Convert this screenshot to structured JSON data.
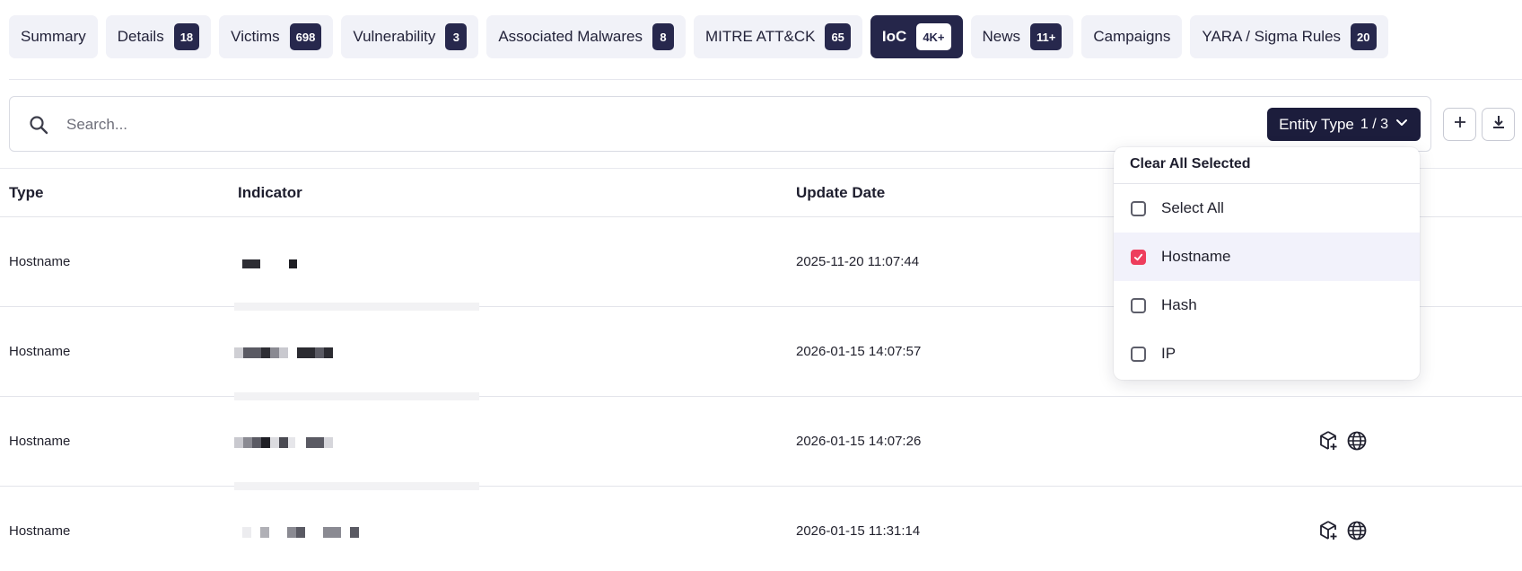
{
  "tabs": [
    {
      "label": "Summary",
      "badge": null
    },
    {
      "label": "Details",
      "badge": "18"
    },
    {
      "label": "Victims",
      "badge": "698"
    },
    {
      "label": "Vulnerability",
      "badge": "3"
    },
    {
      "label": "Associated Malwares",
      "badge": "8"
    },
    {
      "label": "MITRE ATT&CK",
      "badge": "65"
    },
    {
      "label": "IoC",
      "badge": "4K+",
      "active": true
    },
    {
      "label": "News",
      "badge": "11+"
    },
    {
      "label": "Campaigns",
      "badge": null
    },
    {
      "label": "YARA / Sigma Rules",
      "badge": "20"
    }
  ],
  "search": {
    "placeholder": "Search...",
    "entity_button": {
      "label": "Entity Type",
      "count": "1 / 3"
    }
  },
  "table": {
    "headers": {
      "type": "Type",
      "indicator": "Indicator",
      "update_date": "Update Date"
    },
    "rows": [
      {
        "type": "Hostname",
        "date": "2025-11-20 11:07:44",
        "actions": false
      },
      {
        "type": "Hostname",
        "date": "2026-01-15 14:07:57",
        "actions": false
      },
      {
        "type": "Hostname",
        "date": "2026-01-15 14:07:26",
        "actions": true
      },
      {
        "type": "Hostname",
        "date": "2026-01-15 11:31:14",
        "actions": true
      }
    ]
  },
  "dropdown": {
    "clear_label": "Clear All Selected",
    "options": [
      {
        "label": "Select All",
        "checked": false
      },
      {
        "label": "Hostname",
        "checked": true
      },
      {
        "label": "Hash",
        "checked": false
      },
      {
        "label": "IP",
        "checked": false
      }
    ]
  },
  "icons": {
    "search": "search-icon",
    "chevron": "chevron-down-icon",
    "add": "plus-icon",
    "download": "download-icon",
    "package": "package-add-icon",
    "globe": "globe-icon"
  },
  "colors": {
    "accent_dark": "#1c1d3c",
    "badge": "#27284d",
    "checkbox_checked": "#ee3d5c"
  }
}
